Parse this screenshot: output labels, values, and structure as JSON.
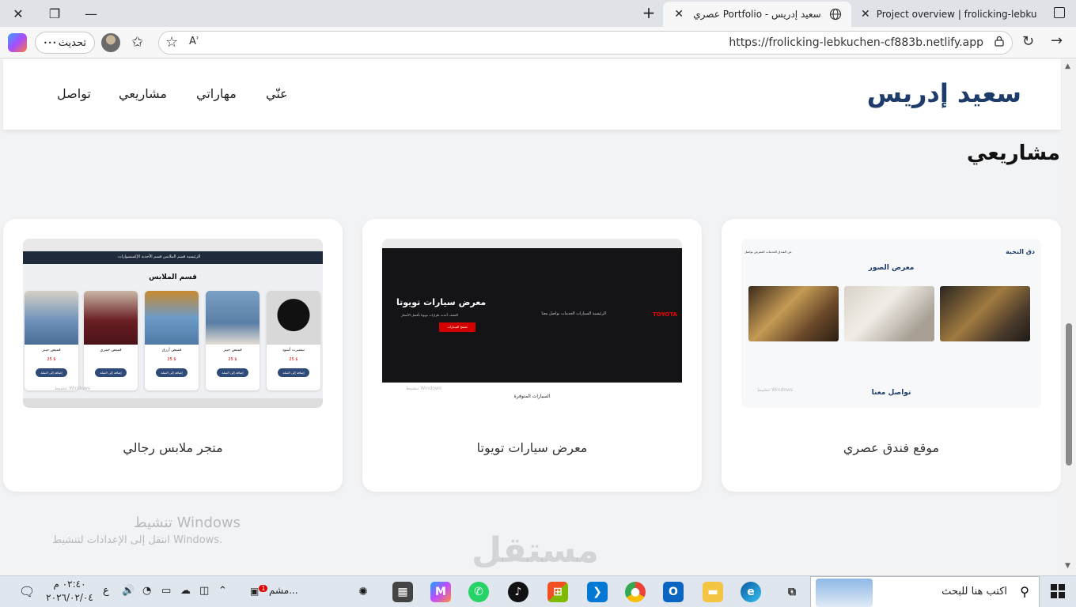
{
  "browser": {
    "tabs": [
      {
        "title": "سعيد إدريس - Portfolio عصري",
        "active": true
      },
      {
        "title": "Project overview | frolicking-lebku",
        "active": false
      }
    ],
    "window_controls": {
      "close": "✕",
      "restore": "❐",
      "minimize": "—"
    },
    "new_tab": "+",
    "update_label": "تحديث",
    "update_dots": "•••",
    "url": "https://frolicking-lebkuchen-cf883b.netlify.app",
    "read_aloud": "Aʾ"
  },
  "site": {
    "logo": "سعيد إدريس",
    "nav": [
      "عنّي",
      "مهاراتي",
      "مشاريعي",
      "تواصل"
    ],
    "section_title": "مشاريعي",
    "projects": [
      {
        "caption": "موقع فندق عصري",
        "thumb": {
          "brand": "دق النخبة",
          "nav": "عن الفندق   الخدمات   المعرض   تواصل",
          "gallery_title": "معرض الصور",
          "contact_title": "تواصل معنا",
          "watermark": "تنشيط Windows"
        }
      },
      {
        "caption": "معرض سيارات تويوتا",
        "thumb": {
          "brand": "TOYOTA",
          "nav": "الرئيسية   السيارات   الخدمات   تواصل معنا",
          "hero_title": "معرض سيارات تويوتا",
          "hero_sub": "اكتشف أحدث طرازات تويوتا بأفضل الأسعار",
          "cta": "تصفح السيارات",
          "bottom_title": "السيارات المتوفرة",
          "watermark": "تنشيط Windows"
        }
      },
      {
        "caption": "متجر ملابس رجالي",
        "thumb": {
          "title": "قسم الملابس",
          "nav": "الرئيسية   قسم الملابس   قسم الأحذية   الإكسسوارات",
          "items": [
            {
              "name": "تيشيرت أسود",
              "price": "25 $",
              "btn": "إضافة إلى السلة"
            },
            {
              "name": "قميص جينز",
              "price": "25 $",
              "btn": "إضافة إلى السلة"
            },
            {
              "name": "قميص أزرق",
              "price": "25 $",
              "btn": "إضافة إلى السلة"
            },
            {
              "name": "قميص خمري",
              "price": "",
              "btn": "إضافة إلى السلة"
            },
            {
              "name": "قميص جينز",
              "price": "25 $",
              "btn": "إضافة إلى السلة"
            }
          ],
          "watermark": "تنشيط Windows"
        }
      }
    ]
  },
  "windows_activation": {
    "title": "تنشيط Windows",
    "subtitle": "انتقل إلى الإعدادات لتنشيط Windows."
  },
  "watermark_logo": "مستقل",
  "taskbar": {
    "search_placeholder": "اكتب هنا للبحث",
    "clock_time": "٠٢:٤٠ م",
    "clock_date": "٢٠٢٦/٠٢/٠٤",
    "lang": "ع",
    "apps_label": "مشم...",
    "badge_count": "1"
  },
  "colors": {
    "logo": "#1d3b6b",
    "toyota_red": "#d40000",
    "store_nav": "#1f2b3d"
  }
}
